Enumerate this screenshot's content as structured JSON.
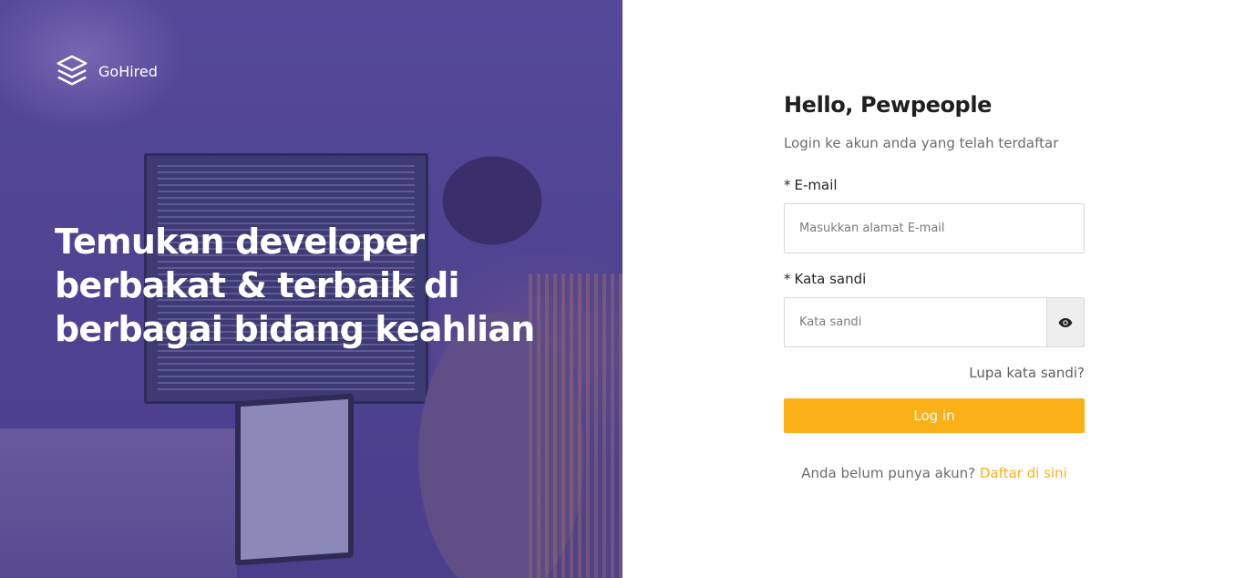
{
  "brand": {
    "name": "GoHired",
    "logo_icon": "stacked-layers-icon"
  },
  "hero": {
    "headline": "Temukan developer berbakat & terbaik di berbagai bidang keahlian",
    "overlay_color": "#4f4392"
  },
  "login": {
    "greeting": "Hello, Pewpeople",
    "subtitle": "Login ke akun anda yang telah terdaftar",
    "email": {
      "required_mark": "*",
      "label": "E-mail",
      "placeholder": "Masukkan alamat E-mail",
      "value": ""
    },
    "password": {
      "required_mark": "*",
      "label": "Kata sandi",
      "placeholder": "Kata sandi",
      "value": "",
      "toggle_icon": "eye-icon"
    },
    "forgot_link": "Lupa kata sandi?",
    "submit_label": "Log in",
    "register_prompt": "Anda belum punya akun?",
    "register_link": "Daftar di sini"
  },
  "colors": {
    "accent": "#fbb017",
    "text_dark": "#1f1f1f",
    "text_muted": "#6b6b6b",
    "border": "#d9d9d9"
  }
}
